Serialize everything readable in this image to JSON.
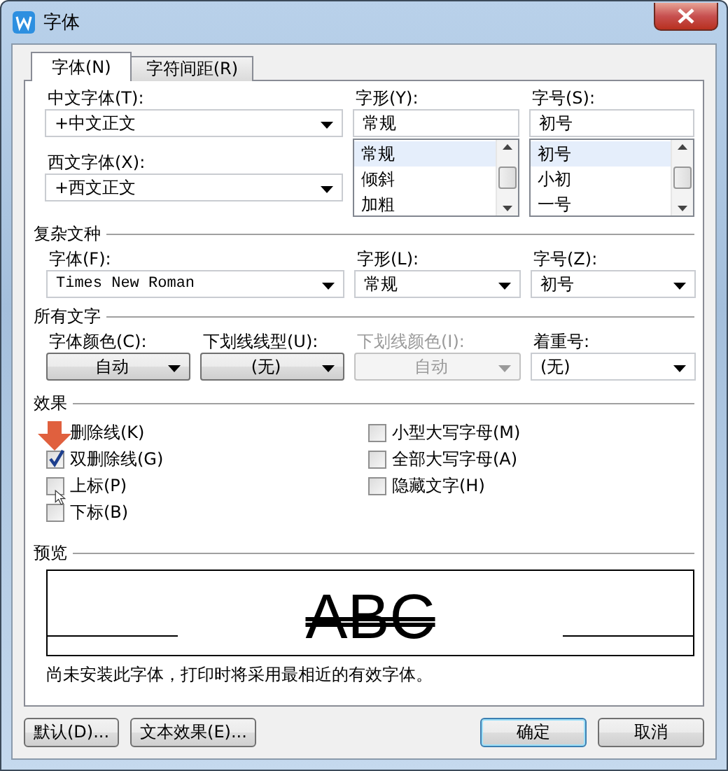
{
  "window": {
    "title": "字体"
  },
  "tabs": [
    {
      "label": "字体(N)",
      "selected": true
    },
    {
      "label": "字符间距(R)",
      "selected": false
    }
  ],
  "chinese_font": {
    "label": "中文字体(T):",
    "value": "+中文正文"
  },
  "western_font": {
    "label": "西文字体(X):",
    "value": "+西文正文"
  },
  "font_style": {
    "label": "字形(Y):",
    "value": "常规",
    "options": [
      {
        "label": "常规",
        "selected": true
      },
      {
        "label": "倾斜",
        "selected": false
      },
      {
        "label": "加粗",
        "selected": false
      }
    ]
  },
  "font_size": {
    "label": "字号(S):",
    "value": "初号",
    "options": [
      {
        "label": "初号",
        "selected": true
      },
      {
        "label": "小初",
        "selected": false
      },
      {
        "label": "一号",
        "selected": false
      }
    ]
  },
  "complex_script": {
    "title": "复杂文种",
    "fields": [
      {
        "label": "字体(F):",
        "value": "Times New Roman",
        "kind": "field",
        "disabled": false
      },
      {
        "label": "字形(L):",
        "value": "常规",
        "kind": "field",
        "disabled": false
      },
      {
        "label": "字号(Z):",
        "value": "初号",
        "kind": "field",
        "disabled": false
      }
    ]
  },
  "all_text": {
    "title": "所有文字",
    "fields": [
      {
        "label": "字体颜色(C):",
        "value": "自动",
        "kind": "button",
        "disabled": false
      },
      {
        "label": "下划线线型(U):",
        "value": "(无)",
        "kind": "button",
        "disabled": false
      },
      {
        "label": "下划线颜色(I):",
        "value": "自动",
        "kind": "button",
        "disabled": true
      },
      {
        "label": "着重号:",
        "value": "(无)",
        "kind": "field",
        "disabled": false
      }
    ]
  },
  "effects": {
    "title": "效果",
    "options": [
      {
        "label": "删除线(K)"
      },
      {
        "label": "双删除线(G)",
        "checked": true
      },
      {
        "label": "上标(P)",
        "checked": false
      },
      {
        "label": "下标(B)",
        "checked": false
      },
      {
        "label": "小型大写字母(M)",
        "checked": false
      },
      {
        "label": "全部大写字母(A)",
        "checked": false
      },
      {
        "label": "隐藏文字(H)",
        "checked": false
      }
    ]
  },
  "preview": {
    "title": "预览",
    "sample": "ABC",
    "note": "尚未安装此字体，打印时将采用最相近的有效字体。"
  },
  "buttons": [
    {
      "label": "默认(D)...",
      "kind": "normal"
    },
    {
      "label": "文本效果(E)...",
      "kind": "normal"
    },
    {
      "label": "确定",
      "kind": "default"
    },
    {
      "label": "取消",
      "kind": "normal"
    }
  ]
}
